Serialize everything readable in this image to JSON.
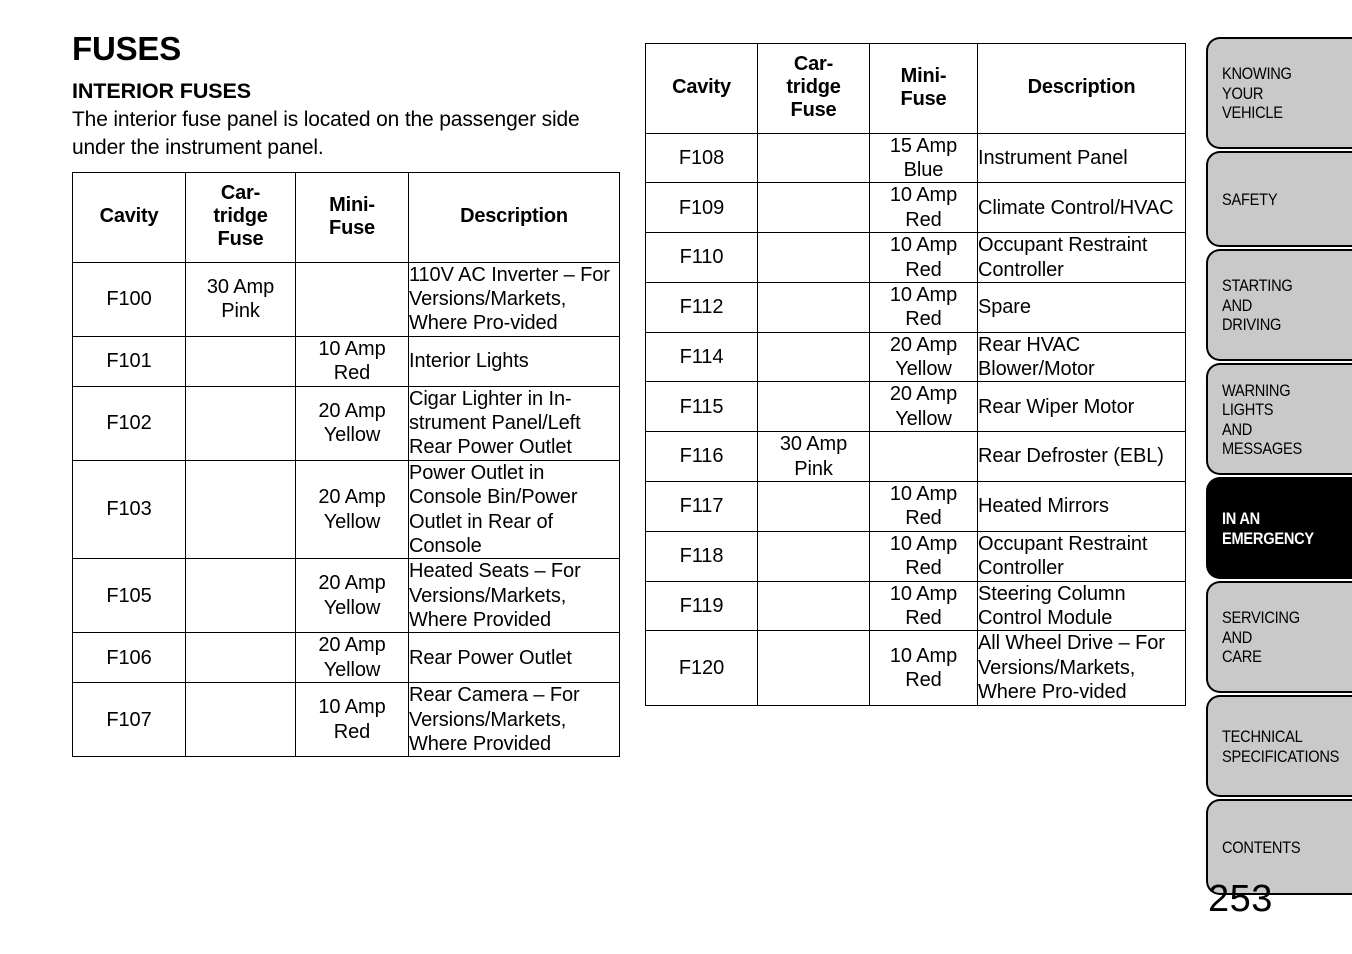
{
  "page": {
    "title": "FUSES",
    "section_heading": "INTERIOR FUSES",
    "intro_paragraph": "The interior fuse panel is located on the passenger side under the instrument panel.",
    "page_number": "253"
  },
  "table_columns": {
    "cavity": "Cavity",
    "cartridge_fuse": "Car-\ntridge\nFuse",
    "mini_fuse": "Mini-\nFuse",
    "description": "Description"
  },
  "left_table": {
    "rows": [
      {
        "cavity": "F100",
        "cartridge_fuse": "30 Amp\nPink",
        "mini_fuse": "",
        "description": "110V AC Inverter – For Versions/Markets, Where Pro-vided"
      },
      {
        "cavity": "F101",
        "cartridge_fuse": "",
        "mini_fuse": "10 Amp\nRed",
        "description": "Interior Lights"
      },
      {
        "cavity": "F102",
        "cartridge_fuse": "",
        "mini_fuse": "20 Amp\nYellow",
        "description": "Cigar Lighter in In-strument Panel/Left Rear Power Outlet"
      },
      {
        "cavity": "F103",
        "cartridge_fuse": "",
        "mini_fuse": "20 Amp\nYellow",
        "description": "Power Outlet in Console Bin/Power Outlet in Rear of Console"
      },
      {
        "cavity": "F105",
        "cartridge_fuse": "",
        "mini_fuse": "20 Amp\nYellow",
        "description": "Heated Seats – For Versions/Markets, Where Provided"
      },
      {
        "cavity": "F106",
        "cartridge_fuse": "",
        "mini_fuse": "20 Amp\nYellow",
        "description": "Rear Power Outlet"
      },
      {
        "cavity": "F107",
        "cartridge_fuse": "",
        "mini_fuse": "10 Amp\nRed",
        "description": "Rear Camera – For Versions/Markets, Where Provided"
      }
    ]
  },
  "right_table": {
    "rows": [
      {
        "cavity": "F108",
        "cartridge_fuse": "",
        "mini_fuse": "15 Amp\nBlue",
        "description": "Instrument Panel"
      },
      {
        "cavity": "F109",
        "cartridge_fuse": "",
        "mini_fuse": "10 Amp\nRed",
        "description": "Climate Control/HVAC"
      },
      {
        "cavity": "F110",
        "cartridge_fuse": "",
        "mini_fuse": "10 Amp\nRed",
        "description": "Occupant Restraint Controller"
      },
      {
        "cavity": "F112",
        "cartridge_fuse": "",
        "mini_fuse": "10 Amp\nRed",
        "description": "Spare"
      },
      {
        "cavity": "F114",
        "cartridge_fuse": "",
        "mini_fuse": "20 Amp\nYellow",
        "description": "Rear HVAC Blower/Motor"
      },
      {
        "cavity": "F115",
        "cartridge_fuse": "",
        "mini_fuse": "20 Amp\nYellow",
        "description": "Rear Wiper Motor"
      },
      {
        "cavity": "F116",
        "cartridge_fuse": "30 Amp\nPink",
        "mini_fuse": "",
        "description": "Rear Defroster (EBL)"
      },
      {
        "cavity": "F117",
        "cartridge_fuse": "",
        "mini_fuse": "10 Amp\nRed",
        "description": "Heated Mirrors"
      },
      {
        "cavity": "F118",
        "cartridge_fuse": "",
        "mini_fuse": "10 Amp\nRed",
        "description": "Occupant Restraint Controller"
      },
      {
        "cavity": "F119",
        "cartridge_fuse": "",
        "mini_fuse": "10 Amp\nRed",
        "description": "Steering Column Control Module"
      },
      {
        "cavity": "F120",
        "cartridge_fuse": "",
        "mini_fuse": "10 Amp\nRed",
        "description": "All Wheel Drive – For Versions/Markets, Where Pro-vided"
      }
    ]
  },
  "side_tabs": {
    "active_index": 4,
    "colors": {
      "inactive_bg": "#c9c9c9",
      "active_bg": "#000000",
      "active_text": "#ffffff"
    },
    "items": [
      {
        "label": "KNOWING\nYOUR\nVEHICLE",
        "lines": 3
      },
      {
        "label": "SAFETY",
        "lines": 1
      },
      {
        "label": "STARTING\nAND\nDRIVING",
        "lines": 3
      },
      {
        "label": "WARNING\nLIGHTS\nAND\nMESSAGES",
        "lines": 4
      },
      {
        "label": "IN AN\nEMERGENCY",
        "lines": 2
      },
      {
        "label": "SERVICING\nAND\nCARE",
        "lines": 3
      },
      {
        "label": "TECHNICAL\nSPECIFICATIONS",
        "lines": 2
      },
      {
        "label": "CONTENTS",
        "lines": 1
      }
    ]
  }
}
